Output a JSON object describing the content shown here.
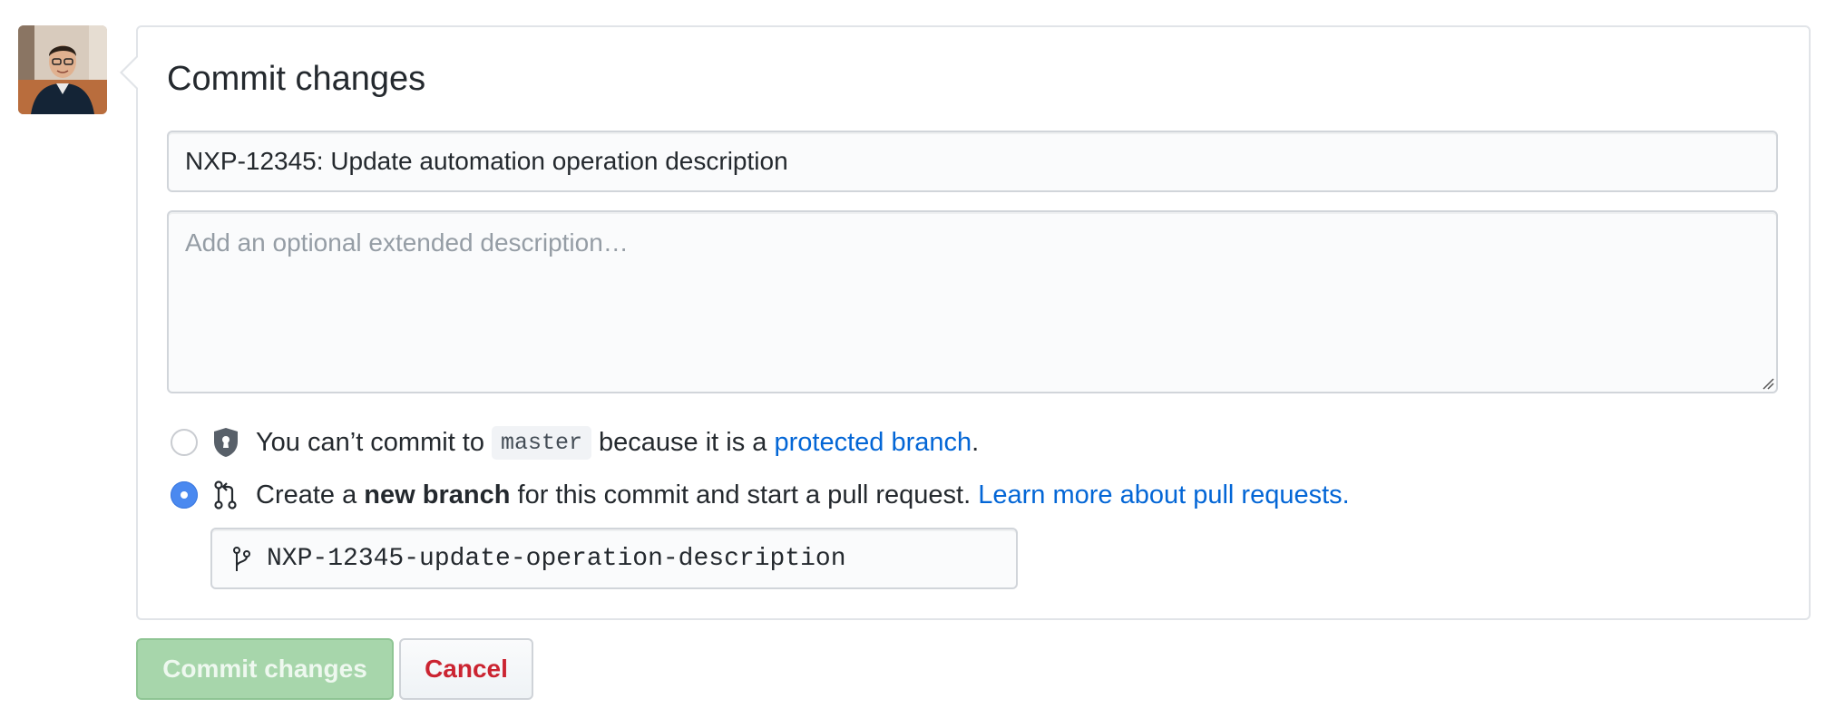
{
  "avatar": {
    "icon": "user-avatar-photo"
  },
  "commit_form": {
    "title": "Commit changes",
    "summary_value": "NXP-12345: Update automation operation description",
    "description_placeholder": "Add an optional extended description…",
    "options": {
      "protected": {
        "text_before": "You can’t commit to",
        "branch_code": "master",
        "text_middle": "because it is a",
        "link": "protected branch",
        "text_after": ".",
        "icon": "shield-lock-icon",
        "selected": false
      },
      "new_branch": {
        "text_before": "Create a",
        "bold": "new branch",
        "text_middle": "for this commit and start a pull request.",
        "link": "Learn more about pull requests.",
        "icon": "git-pull-request-icon",
        "selected": true
      }
    },
    "branch_name_value": "NXP-12345-update-operation-description",
    "branch_icon": "git-branch-icon"
  },
  "buttons": {
    "commit_label": "Commit changes",
    "cancel_label": "Cancel"
  },
  "colors": {
    "link": "#0366d6",
    "commit_button_disabled": "#a7d6ab",
    "cancel_text": "#cb2431",
    "radio_selected": "#4a89f0"
  }
}
